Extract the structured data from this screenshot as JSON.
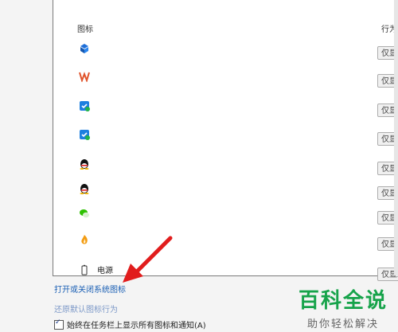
{
  "columns": {
    "icon": "图标",
    "behavior": "行为"
  },
  "rows": [
    {
      "icon": "dropbox-icon",
      "name": "",
      "behavior": "仅显示"
    },
    {
      "icon": "wps-icon",
      "name": "",
      "behavior": "仅显示"
    },
    {
      "icon": "tencent-manager-icon",
      "name": "",
      "behavior": "仅显示"
    },
    {
      "icon": "tencent-manager-icon",
      "name": "",
      "behavior": "仅显示"
    },
    {
      "icon": "qq-icon",
      "name": "",
      "behavior": "仅显示"
    },
    {
      "icon": "qq-icon",
      "name": "",
      "behavior": "仅显示"
    },
    {
      "icon": "wechat-icon",
      "name": "",
      "behavior": "仅显示"
    },
    {
      "icon": "fire-icon",
      "name": "",
      "behavior": "仅显示"
    },
    {
      "icon": "battery-icon",
      "name": "电源",
      "behavior": "仅显示"
    }
  ],
  "links": {
    "toggle_system_icons": "打开或关闭系统图标",
    "restore_defaults": "还原默认图标行为"
  },
  "checkbox": {
    "label": "始终在任务栏上显示所有图标和通知(A)",
    "checked": true
  },
  "watermark": {
    "title": "百科全说",
    "subtitle": "助你轻松解决"
  },
  "colors": {
    "link": "#1a5fb4",
    "arrow": "#e11d1d",
    "watermark": "#16a34a"
  }
}
